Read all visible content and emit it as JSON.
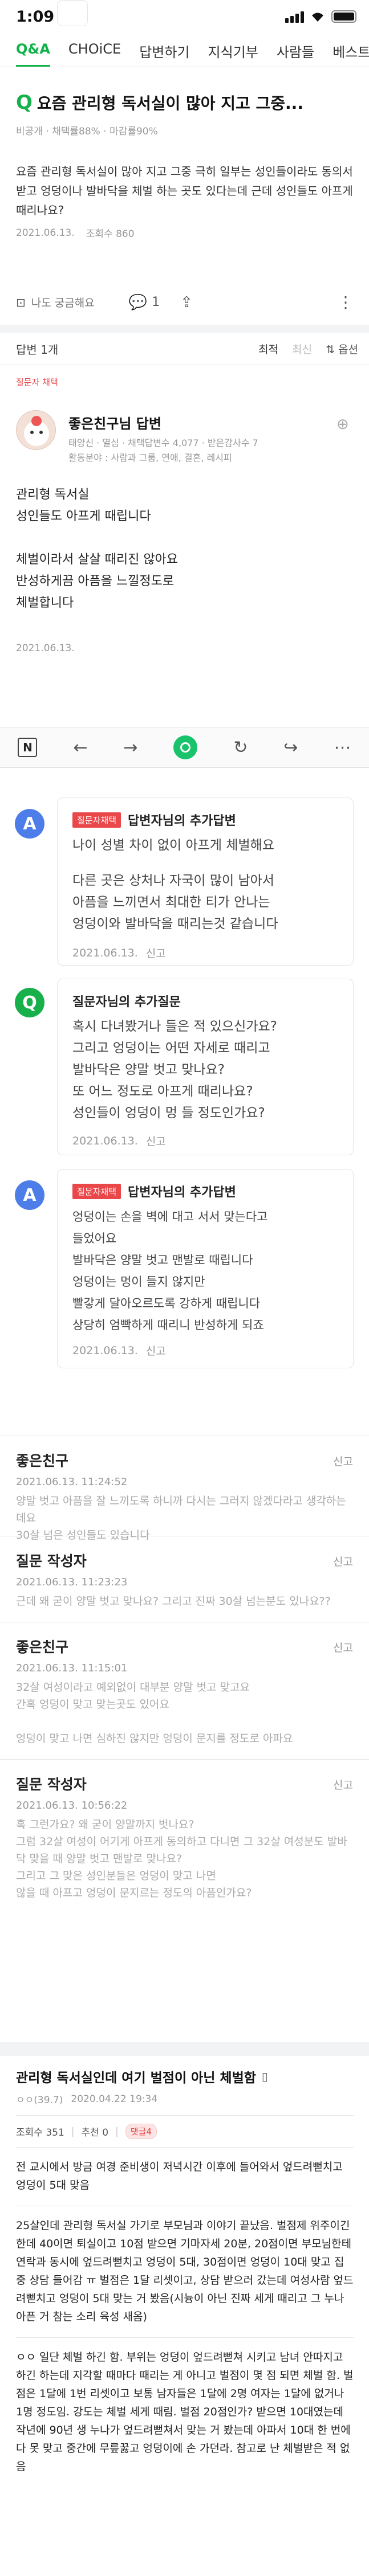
{
  "status": {
    "time": "1:09"
  },
  "tabs": [
    "Q&A",
    "CHOiCE",
    "답변하기",
    "지식기부",
    "사람들",
    "베스트"
  ],
  "question": {
    "title": "요즘 관리형 독서실이 많아 지고 그중...",
    "meta": "비공개 · 채택률88% · 마감률90%",
    "body": "요즘 관리형 독서실이 많아 지고 그중 극히 일부는 성인들이라도 동의서 받고 엉덩이나 발바닥을 체벌 하는 곳도 있다는데 근데 성인들도 아프게 때리나요?",
    "date": "2021.06.13.",
    "views": "조회수 860",
    "curious": "나도 궁금해요",
    "comment_count": "1"
  },
  "answer_header": {
    "label": "답변 1개",
    "sort_best": "최적",
    "sort_new": "최신",
    "options": "옵션"
  },
  "answer": {
    "tag": "질문자 채택",
    "name": "좋은친구님 답변",
    "grade": "태양신 · 열심 · 채택답변수 4,077 · 받은감사수 7",
    "field": "활동분야 : 사람과 그룹, 연애, 결혼, 레시피",
    "lines": [
      "관리형 독서실",
      "성인들도 아프게 때립니다",
      "",
      "체벌이라서 살살 때리진 않아요",
      "반성하게끔 아픔을 느낄정도로",
      "체벌합니다"
    ],
    "date": "2021.06.13."
  },
  "followups": [
    {
      "kind": "a",
      "badge": "질문자채택",
      "title": "답변자님의 추가답변",
      "lines": [
        "나이 성별 차이 없이 아프게 체벌해요",
        "",
        "다른 곳은 상처나 자국이 많이 남아서",
        "아픔을 느끼면서 최대한 티가 안나는",
        "엉덩이와 발바닥을 때리는것 같습니다"
      ],
      "date": "2021.06.13.",
      "report": "신고"
    },
    {
      "kind": "q",
      "badge": "",
      "title": "질문자님의 추가질문",
      "lines": [
        "혹시 다녀봤거나 들은 적 있으신가요?",
        "그리고 엉덩이는 어떤 자세로 때리고",
        "발바닥은 양말 벗고 맞나요?",
        "또 어느 정도로 아프게 때리나요?",
        "성인들이 엉덩이 멍 들 정도인가요?"
      ],
      "date": "2021.06.13.",
      "report": "신고"
    },
    {
      "kind": "a",
      "badge": "질문자채택",
      "title": "답변자님의 추가답변",
      "lines": [
        "엉덩이는 손을 벽에 대고 서서 맞는다고",
        "들었어요",
        "발바닥은 양말 벗고 맨발로 때립니다",
        "엉덩이는 멍이 들지 않지만",
        "빨갛게 달아오르도록 강하게 때립니다",
        "상당히 엄빡하게 때리니 반성하게 되죠"
      ],
      "date": "2021.06.13.",
      "report": "신고"
    }
  ],
  "comments": [
    {
      "name": "좋은친구",
      "date": "2021.06.13. 11:24:52",
      "body": "양말 벗고 아픔을 잘 느끼도록 하니까 다시는 그러지 않겠다라고 생각하는데요\n30살 넘은 성인들도 있습니다",
      "report": "신고"
    },
    {
      "name": "질문 작성자",
      "date": "2021.06.13. 11:23:23",
      "body": "근데 왜 굳이 양말 벗고 맞나요? 그리고 진짜 30살 넘는분도 있나요??",
      "report": "신고"
    },
    {
      "name": "좋은친구",
      "date": "2021.06.13. 11:15:01",
      "body": "32살 여성이라고 예외없이 대부분 양말 벗고 맞고요\n간혹 엉덩이 맞고 맞는곳도 있어요\n\n엉덩이 맞고 나면 심하진 않지만 엉덩이 문지를 정도로 아파요",
      "report": "신고"
    },
    {
      "name": "질문 작성자",
      "date": "2021.06.13. 10:56:22",
      "body": "혹 그런가요? 왜 굳이 양말까지 벗나요?\n그럼 32살 여성이 어기게 아프게 동의하고 다니면 그 32살 여성분도 발바닥 맞을 때 양말 벗고 맨발로 맞나요?\n그리고 그 맞은 성인분들은 엉덩이 맞고 나면\n않을 때 아프고 엉덩이 문지르는 정도의 아픔인가요?",
      "report": "신고"
    }
  ],
  "related": {
    "title": "관리형 독서실인데 여기 벌점이 아닌 체벌함",
    "author": "ㅇㅇ(39.7)",
    "date": "2020.04.22 19:34",
    "views": "조회수 351",
    "recommend": "추천 0",
    "comments": "댓글4",
    "paragraphs": [
      "전 교시에서 방금 여경 준비생이 저녁시간 이후에 들어와서 엎드려뻗치고 엉덩이 5대 맞음",
      "25살인데 관리형 독서실 가기로 부모님과 이야기 끝났음. 벌점제 위주이긴 한데 40이면 퇴실이고 10점 받으면 기마자세 20분, 20점이면 부모님한테 연락과 동시에 엎드려뻗치고 엉덩이 5대, 30점이면 엉덩이 10대 맞고 집중 상담 들어감 ㅠ 벌점은 1달 리셋이고, 상담 받으러 갔는데 여성사람 엎드려뻗치고 엉덩이 5대 맞는 거 봤음(시늉이 아닌 진짜 세게 때리고 그 누나 아픈 거 참는 소리 육성 새옴)",
      "ㅇㅇ 일단 체벌 하긴 함. 부위는 엉덩이 엎드려뻗쳐 시키고 남녀 안따지고 하긴 하는데 지각할 때마다 때리는 게 아니고 벌점이 몇 점 되면 체벌 함. 벌점은 1달에 1번 리셋이고 보통 남자들은 1달에 2명 여자는 1달에 없거나 1명 정도임. 강도는 체벌 세게 때림. 벌점 20점인가? 받으면 10대였는데 작년에 90년 생 누나가 엎드려뻗쳐서 맞는 거 봤는데 아파서 10대 한 번에 다 못 맞고 중간에 무릎꿇고 엉덩이에 손 가던라. 참고로 난 체벌받은 적 없음"
    ]
  }
}
